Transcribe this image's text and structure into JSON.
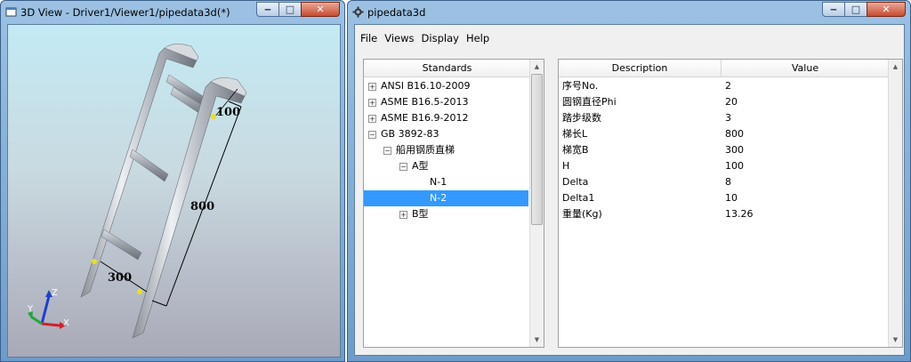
{
  "view3d": {
    "title": "3D View - Driver1/Viewer1/pipedata3d(*)",
    "dims": {
      "top": "100",
      "length": "800",
      "width": "300"
    },
    "axes": {
      "x": "X",
      "y": "Y",
      "z": "Z"
    }
  },
  "pipedata": {
    "title": "pipedata3d",
    "menu": [
      "File",
      "Views",
      "Display",
      "Help"
    ],
    "tree": {
      "header": "Standards",
      "items": [
        {
          "label": "ANSI B16.10-2009",
          "exp": "+"
        },
        {
          "label": "ASME B16.5-2013",
          "exp": "+"
        },
        {
          "label": "ASME B16.9-2012",
          "exp": "+"
        },
        {
          "label": "GB 3892-83",
          "exp": "−"
        },
        {
          "label": "船用钢质直梯",
          "exp": "−"
        },
        {
          "label": "A型",
          "exp": "−"
        },
        {
          "label": "N-1",
          "exp": ""
        },
        {
          "label": "N-2",
          "exp": "",
          "selected": true
        },
        {
          "label": "B型",
          "exp": "+"
        }
      ]
    },
    "table": {
      "headers": [
        "Description",
        "Value"
      ],
      "rows": [
        {
          "desc": "序号No.",
          "value": "2"
        },
        {
          "desc": "圆钢直径Phi",
          "value": "20"
        },
        {
          "desc": "踏步级数",
          "value": "3"
        },
        {
          "desc": "梯长L",
          "value": "800"
        },
        {
          "desc": "梯宽B",
          "value": "300"
        },
        {
          "desc": "H",
          "value": "100"
        },
        {
          "desc": "Delta",
          "value": "8"
        },
        {
          "desc": "Delta1",
          "value": "10"
        },
        {
          "desc": "重量(Kg)",
          "value": "13.26"
        }
      ]
    }
  },
  "colors": {
    "selection": "#3399ff",
    "frame": "#6d9ccb",
    "close": "#c84a2e"
  }
}
